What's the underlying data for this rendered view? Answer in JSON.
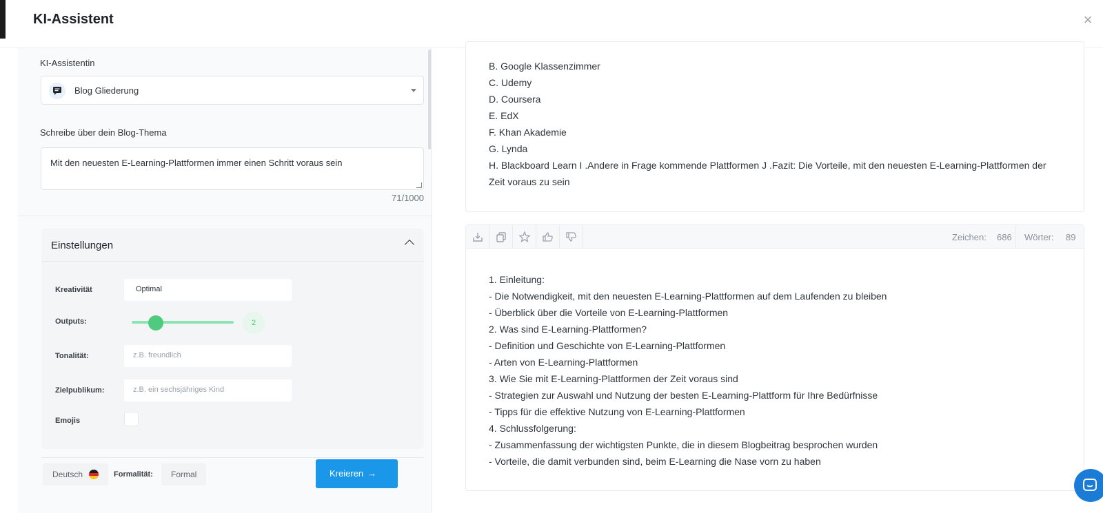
{
  "header": {
    "title": "KI-Assistent"
  },
  "left": {
    "assistant_label": "KI-Assistentin",
    "assistant_select": "Blog Gliederung",
    "topic_label": "Schreibe über dein Blog-Thema",
    "topic_value": "Mit den neuesten E-Learning-Plattformen immer einen Schritt voraus sein",
    "counter": "71/1000",
    "settings": {
      "title": "Einstellungen",
      "creativity_label": "Kreativität",
      "creativity_value": "Optimal",
      "outputs_label": "Outputs:",
      "outputs_value": "2",
      "tone_label": "Tonalität:",
      "tone_placeholder": "z.B. freundlich",
      "audience_label": "Zielpublikum:",
      "audience_placeholder": "z.B. ein sechsjähriges Kind",
      "emojis_label": "Emojis"
    },
    "language": "Deutsch",
    "formality_label": "Formalität:",
    "formality_value": "Formal",
    "create_button": "Kreieren"
  },
  "output1": {
    "lines": [
      "B. Google Klassenzimmer",
      "C. Udemy",
      "D. Coursera",
      "E. EdX",
      "F. Khan Akademie",
      "G. Lynda",
      "H. Blackboard Learn I .Andere in Frage kommende Plattformen J .Fazit: Die Vorteile, mit den neuesten E-Learning-Plattformen der Zeit voraus zu sein"
    ]
  },
  "output2": {
    "chars_label": "Zeichen:",
    "chars_value": "686",
    "words_label": "Wörter:",
    "words_value": "89",
    "lines": [
      "1. Einleitung:",
      "- Die Notwendigkeit, mit den neuesten E-Learning-Plattformen auf dem Laufenden zu bleiben",
      "- Überblick über die Vorteile von E-Learning-Plattformen",
      "2. Was sind E-Learning-Plattformen?",
      "- Definition und Geschichte von E-Learning-Plattformen",
      "- Arten von E-Learning-Plattformen",
      "3. Wie Sie mit E-Learning-Plattformen der Zeit voraus sind",
      "- Strategien zur Auswahl und Nutzung der besten E-Learning-Plattform für Ihre Bedürfnisse",
      "- Tipps für die effektive Nutzung von E-Learning-Plattformen",
      "4. Schlussfolgerung:",
      "- Zusammenfassung der wichtigsten Punkte, die in diesem Blogbeitrag besprochen wurden",
      "- Vorteile, die damit verbunden sind, beim E-Learning die Nase vorn zu haben"
    ]
  },
  "icons": [
    "close-icon",
    "chat-bubble-icon",
    "chevron-down-icon",
    "chevron-up-icon",
    "download-icon",
    "copy-icon",
    "star-icon",
    "thumbs-up-icon",
    "thumbs-down-icon",
    "arrow-right-icon",
    "messenger-icon"
  ],
  "colors": {
    "accent": "#1a97e8",
    "slider": "#4fca7f",
    "panel": "#f8fafc"
  }
}
